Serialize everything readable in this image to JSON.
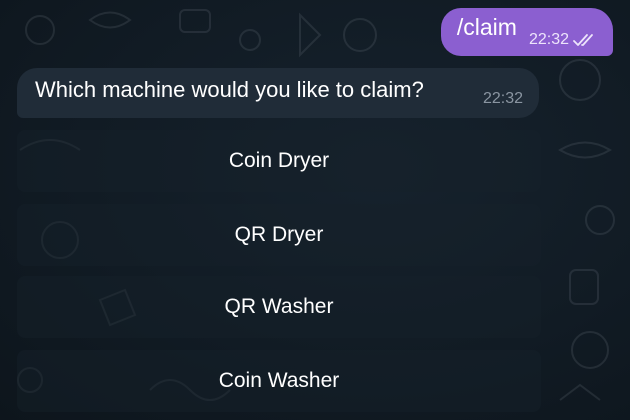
{
  "chat": {
    "outgoing": {
      "text": "/claim",
      "time": "22:32",
      "status_icon": "double-check-icon"
    },
    "incoming": {
      "text": "Which machine would you like to claim?",
      "time": "22:32"
    },
    "keyboard": {
      "buttons": [
        {
          "label": "Coin Dryer"
        },
        {
          "label": "QR Dryer"
        },
        {
          "label": "QR Washer"
        },
        {
          "label": "Coin Washer"
        }
      ]
    }
  },
  "colors": {
    "background": "#0f1821",
    "outgoing_bubble": "#8b5fd0",
    "incoming_bubble": "#202c38",
    "keyboard_button": "#17212b"
  }
}
